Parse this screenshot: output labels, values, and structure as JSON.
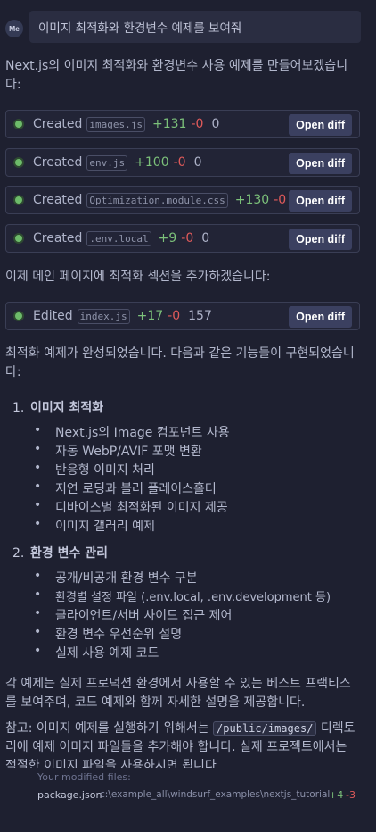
{
  "user": {
    "avatar_initials": "Me",
    "message": "이미지 최적화와 환경변수 예제를 보여줘"
  },
  "intro_text": "Next.js의 이미지 최적화와 환경변수 사용 예제를 만들어보겠습니다:",
  "file_changes": [
    {
      "verb": "Created",
      "file": "images.js",
      "added": "+131",
      "removed": "-0",
      "count": "0",
      "button": "Open diff"
    },
    {
      "verb": "Created",
      "file": "env.js",
      "added": "+100",
      "removed": "-0",
      "count": "0",
      "button": "Open diff"
    },
    {
      "verb": "Created",
      "file": "Optimization.module.css",
      "added": "+130",
      "removed": "-0",
      "count": "0",
      "button": "Open diff"
    },
    {
      "verb": "Created",
      "file": ".env.local",
      "added": "+9",
      "removed": "-0",
      "count": "0",
      "button": "Open diff"
    }
  ],
  "mid_text": "이제 메인 페이지에 최적화 섹션을 추가하겠습니다:",
  "edit_change": {
    "verb": "Edited",
    "file": "index.js",
    "added": "+17",
    "removed": "-0",
    "count": "157",
    "button": "Open diff"
  },
  "summary_text": "최적화 예제가 완성되었습니다. 다음과 같은 기능들이 구현되었습니다:",
  "sections": [
    {
      "number": "1.",
      "title": "이미지 최적화",
      "items": [
        "Next.js의 Image 컴포넌트 사용",
        "자동 WebP/AVIF 포맷 변환",
        "반응형 이미지 처리",
        "지연 로딩과 블러 플레이스홀더",
        "디바이스별 최적화된 이미지 제공",
        "이미지 갤러리 예제"
      ]
    },
    {
      "number": "2.",
      "title": "환경 변수 관리",
      "items": [
        "공개/비공개 환경 변수 구분",
        "환경별 설정 파일 (.env.local, .env.development 등)",
        "클라이언트/서버 사이드 접근 제어",
        "환경 변수 우선순위 설명",
        "실제 사용 예제 코드"
      ]
    }
  ],
  "closing_text": "각 예제는 실제 프로덕션 환경에서 사용할 수 있는 베스트 프랙티스를 보여주며, 코드 예제와 함께 자세한 설명을 제공합니다.",
  "note": {
    "before": "참고: 이미지 예제를 실행하기 위해서는 ",
    "code": "/public/images/",
    "after": " 디렉토리에 예제 이미지 파일들을 추가해야 합니다. 실제 프로젝트에서는 적절한 이미지 파일을 사용하시면 됩니다."
  },
  "footer": {
    "label": "Your modified files:",
    "file": "package.json",
    "path": "c:\\example_all\\windsurf_examples\\nextjs_tutorial",
    "added": "+4",
    "removed": "-3"
  },
  "colors": {
    "background": "#1e2030",
    "added": "#7cc17a",
    "removed": "#e05a5a",
    "button": "#3b4060",
    "status_dot": "#6dbb6a"
  }
}
